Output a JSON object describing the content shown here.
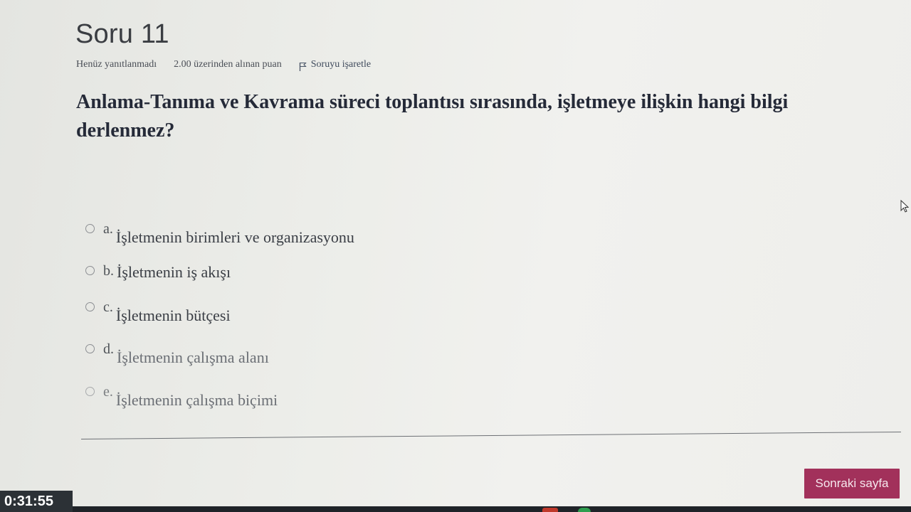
{
  "question": {
    "title": "Soru 11",
    "status": "Henüz yanıtlanmadı",
    "points": "2.00 üzerinden alınan puan",
    "flag_label": "Soruyu işaretle",
    "text": "Anlama-Tanıma ve Kavrama süreci toplantısı sırasında, işletmeye ilişkin hangi bilgi derlenmez?"
  },
  "options": [
    {
      "letter": "a.",
      "text": "İşletmenin birimleri ve organizasyonu"
    },
    {
      "letter": "b.",
      "text": "İşletmenin iş akışı"
    },
    {
      "letter": "c.",
      "text": "İşletmenin bütçesi"
    },
    {
      "letter": "d.",
      "text": "İşletmenin çalışma alanı"
    },
    {
      "letter": "e.",
      "text": "İşletmenin çalışma biçimi"
    }
  ],
  "navigation": {
    "next_label": "Sonraki sayfa"
  },
  "timer": {
    "value": "0:31:55"
  },
  "colors": {
    "next_button": "#a2315b",
    "timer_background": "#2c3136"
  },
  "icons": [
    "flag-icon",
    "radio-icon",
    "mouse-cursor-icon"
  ]
}
